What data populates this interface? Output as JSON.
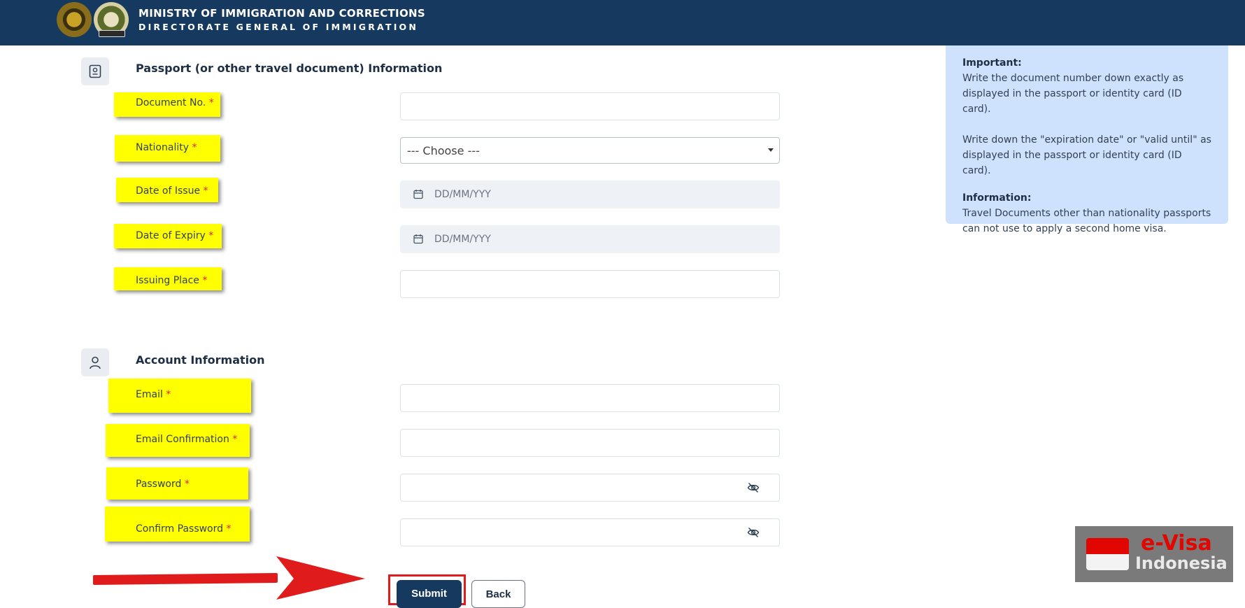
{
  "header": {
    "title": "MINISTRY OF IMMIGRATION AND CORRECTIONS",
    "subtitle": "DIRECTORATE GENERAL OF IMMIGRATION"
  },
  "passport_section": {
    "title": "Passport (or other travel document) Information",
    "fields": {
      "document_no": {
        "label": "Document No.",
        "value": ""
      },
      "nationality": {
        "label": "Nationality",
        "selected": "--- Choose ---"
      },
      "date_of_issue": {
        "label": "Date of Issue",
        "placeholder": "DD/MM/YYY"
      },
      "date_of_expiry": {
        "label": "Date of Expiry",
        "placeholder": "DD/MM/YYY"
      },
      "issuing_place": {
        "label": "Issuing Place",
        "value": ""
      }
    }
  },
  "account_section": {
    "title": "Account Information",
    "fields": {
      "email": {
        "label": "Email",
        "value": ""
      },
      "email_confirmation": {
        "label": "Email Confirmation",
        "value": ""
      },
      "password": {
        "label": "Password",
        "value": ""
      },
      "confirm_password": {
        "label": "Confirm Password",
        "value": ""
      }
    }
  },
  "required_mark": "*",
  "info_panel": {
    "important_label": "Important:",
    "important_text_1": "Write the document number down exactly as displayed in the passport or identity card (ID card).",
    "important_text_2": "Write down the \"expiration date\" or \"valid until\" as displayed in the passport or identity card (ID card).",
    "information_label": "Information:",
    "information_text": "Travel Documents other than nationality passports can not use to apply a second home visa."
  },
  "actions": {
    "submit_label": "Submit",
    "back_label": "Back"
  },
  "watermark": {
    "line1": "e-Visa",
    "line2": "Indonesia"
  },
  "colors": {
    "header_bg": "#163a5f",
    "highlight": "#ffff00",
    "info_bg": "#cfe2fd",
    "annotation_red": "#e01b1b"
  },
  "icons": {
    "passport_section": "passport-icon",
    "account_section": "user-icon",
    "date": "calendar-icon",
    "password_toggle": "eye-off-icon",
    "annotation": "red-arrow"
  }
}
